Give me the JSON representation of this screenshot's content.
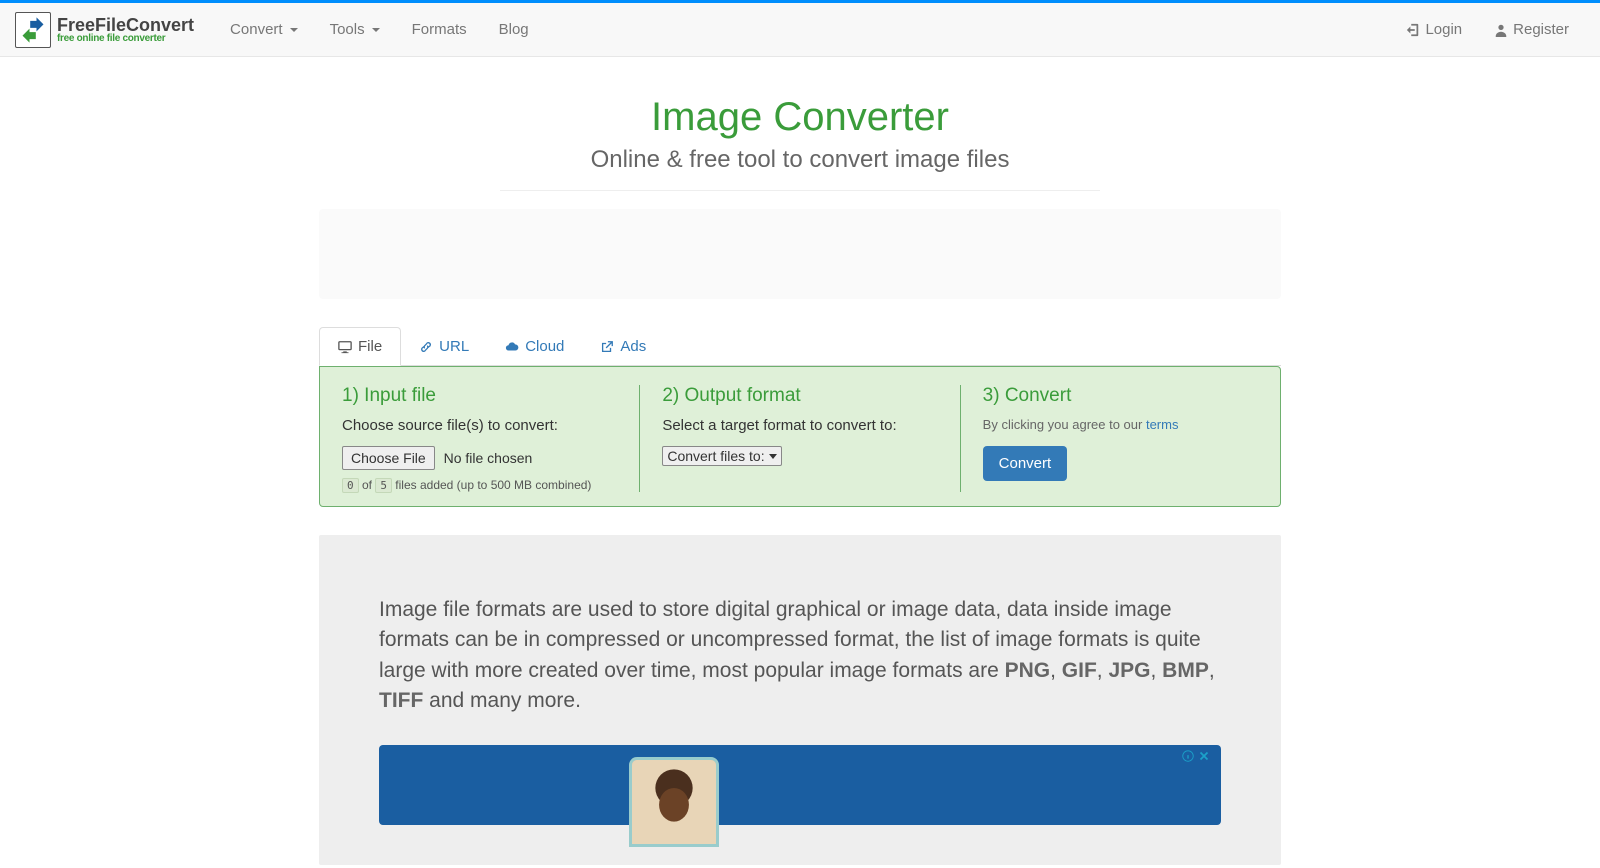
{
  "nav": {
    "brand_title": "FreeFileConvert",
    "brand_sub": "free online file converter",
    "convert": "Convert",
    "tools": "Tools",
    "formats": "Formats",
    "blog": "Blog",
    "login": "Login",
    "register": "Register"
  },
  "page": {
    "title": "Image Converter",
    "subtitle": "Online & free tool to convert image files"
  },
  "tabs": {
    "file": "File",
    "url": "URL",
    "cloud": "Cloud",
    "ads": "Ads"
  },
  "step1": {
    "title": "1) Input file",
    "label": "Choose source file(s) to convert:",
    "choose": "Choose File",
    "nofile": "No file chosen",
    "count_cur": "0",
    "count_of": "of",
    "count_max": "5",
    "count_text": "files added (up to 500 MB combined)"
  },
  "step2": {
    "title": "2) Output format",
    "label": "Select a target format to convert to:",
    "select": "Convert files to:"
  },
  "step3": {
    "title": "3) Convert",
    "terms_pre": "By clicking you agree to our ",
    "terms_link": "terms",
    "button": "Convert"
  },
  "info": {
    "text_pre": "Image file formats are used to store digital graphical or image data, data inside image formats can be in compressed or uncompressed format, the list of image formats is quite large with more created over time, most popular image formats are ",
    "fmt1": "PNG",
    "c1": ", ",
    "fmt2": "GIF",
    "c2": ", ",
    "fmt3": "JPG",
    "c3": ", ",
    "fmt4": "BMP",
    "c4": ", ",
    "fmt5": "TIFF",
    "text_post": " and many more."
  }
}
